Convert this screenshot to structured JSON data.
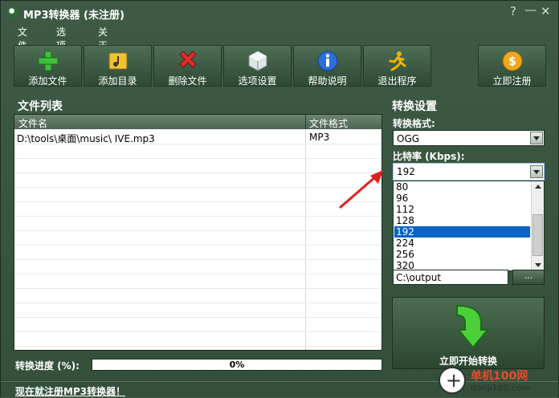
{
  "app": {
    "title": "MP3转换器 (未注册)"
  },
  "titlebar": {
    "help": "?",
    "minimize": "—",
    "close": "✕"
  },
  "menu": {
    "items": [
      "文件(F)",
      "选项(O)",
      "关于(A)"
    ]
  },
  "toolbar": [
    {
      "label": "添加文件",
      "icon": "plus-icon"
    },
    {
      "label": "添加目录",
      "icon": "folder-music-icon"
    },
    {
      "label": "删除文件",
      "icon": "delete-x-icon"
    },
    {
      "label": "选项设置",
      "icon": "settings-cube-icon"
    },
    {
      "label": "帮助说明",
      "icon": "info-icon"
    },
    {
      "label": "退出程序",
      "icon": "exit-runner-icon"
    },
    {
      "label": "立即注册",
      "icon": "dollar-coin-icon"
    }
  ],
  "file_list": {
    "title": "文件列表",
    "headers": [
      "文件名",
      "文件格式"
    ],
    "rows": [
      {
        "name": "D:\\tools\\桌面\\music\\ IVE.mp3",
        "format": "MP3"
      }
    ]
  },
  "settings": {
    "title": "转换设置",
    "format_label": "转换格式:",
    "format_value": "OGG",
    "bitrate_label": "比特率 (Kbps):",
    "bitrate_value": "192",
    "bitrate_options": [
      "80",
      "96",
      "112",
      "128",
      "192",
      "224",
      "256",
      "320"
    ],
    "bitrate_selected": "192",
    "output_path": "C:\\output",
    "browse_label": "...",
    "start_label": "立即开始转换"
  },
  "progress": {
    "label": "转换进度 (%):",
    "value_text": "0%",
    "value": 0
  },
  "status": {
    "register_link": "现在就注册MP3转换器！"
  },
  "watermark": {
    "text": "单机100网",
    "sub": "danji100.com"
  },
  "colors": {
    "accent_green": "#2a8a3a",
    "selection_blue": "#0a63c7",
    "window_bg": "#3f5a44"
  }
}
